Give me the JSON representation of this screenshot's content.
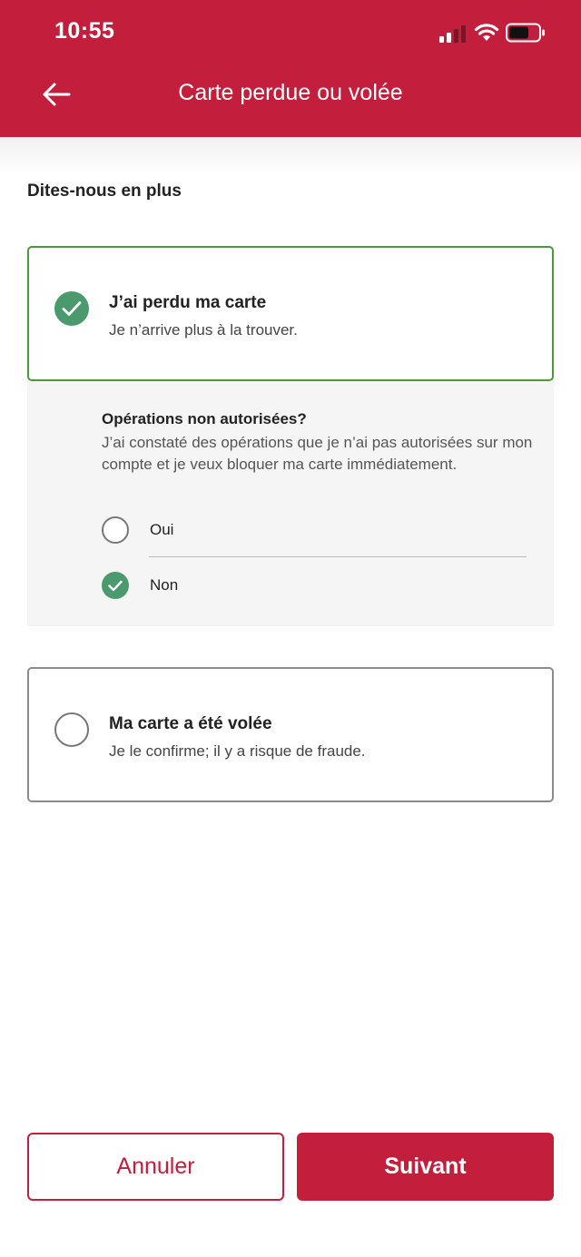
{
  "status_bar": {
    "time": "10:55"
  },
  "header": {
    "title": "Carte perdue ou volée",
    "back_icon": "arrow-left-icon"
  },
  "section": {
    "title": "Dites-nous en plus"
  },
  "options": {
    "lost": {
      "title": "J’ai perdu ma carte",
      "subtitle": "Je n’arrive plus à la trouver.",
      "selected": true
    },
    "stolen": {
      "title": "Ma carte a été volée",
      "subtitle": "Je le confirme; il y a risque de fraude.",
      "selected": false
    }
  },
  "unauthorized": {
    "title": "Opérations non autorisées?",
    "description": "J’ai constaté des opérations que je n’ai pas autorisées sur mon compte et je veux bloquer ma carte immédiatement.",
    "choices": [
      {
        "label": "Oui",
        "selected": false
      },
      {
        "label": "Non",
        "selected": true
      }
    ]
  },
  "footer": {
    "cancel_label": "Annuler",
    "next_label": "Suivant"
  },
  "colors": {
    "brand": "#c41e3d",
    "check_green": "#4a9a6e",
    "selected_border": "#4a9a36"
  }
}
